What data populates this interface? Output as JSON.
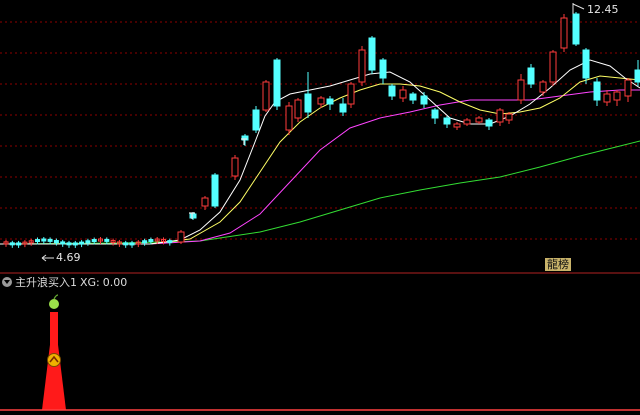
{
  "price_labels": {
    "high": "12.45",
    "low": "4.69"
  },
  "badge_text": "龍榜",
  "indicator": {
    "title": "主升浪买入1",
    "xg_label": "XG:",
    "xg_value": "0.00"
  },
  "colors": {
    "background": "#000000",
    "grid": "#8b0000",
    "candle_up": "#ff3c3c",
    "candle_down": "#54ffff",
    "ma_white": "#ffffff",
    "ma_yellow": "#ffff66",
    "ma_magenta": "#ff44ff",
    "ma_green": "#33dd33",
    "signal": "#ff1a1a"
  },
  "icons": [
    "collapse-arrow-icon",
    "apple-icon",
    "chevron-up-icon",
    "flag-icon"
  ]
}
